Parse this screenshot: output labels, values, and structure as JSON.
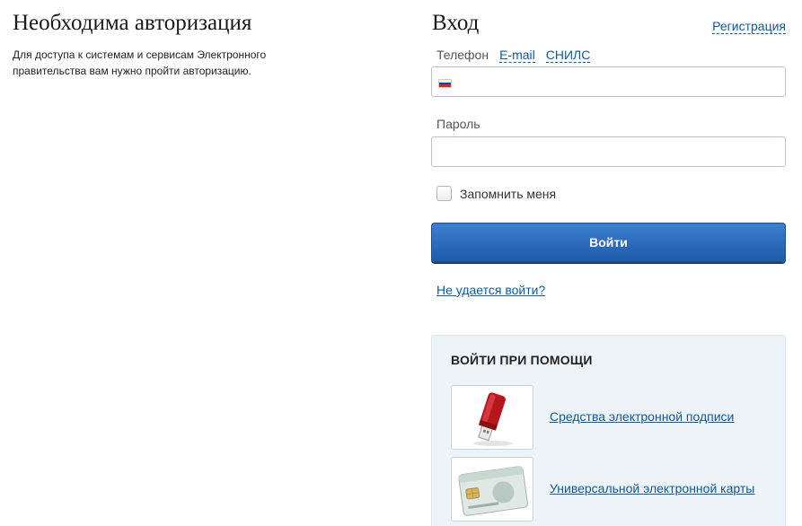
{
  "left": {
    "title": "Необходима авторизация",
    "description": "Для доступа к системам и сервисам Электронного правительства вам нужно пройти авторизацию."
  },
  "login": {
    "title": "Вход",
    "register_link": "Регистрация",
    "tabs": [
      {
        "label": "Телефон",
        "active": true
      },
      {
        "label": "E-mail",
        "active": false
      },
      {
        "label": "СНИЛС",
        "active": false
      }
    ],
    "phone_value": "",
    "password_label": "Пароль",
    "password_value": "",
    "remember_label": "Запомнить меня",
    "remember_checked": false,
    "submit_label": "Войти",
    "cant_login_link": "Не удается войти?"
  },
  "alt": {
    "title": "ВОЙТИ ПРИ ПОМОЩИ",
    "methods": [
      {
        "icon": "usb-token-icon",
        "label": "Средства электронной подписи"
      },
      {
        "icon": "smart-card-icon",
        "label": "Универсальной электронной карты"
      }
    ]
  },
  "colors": {
    "link": "#0f5a9c",
    "button_top": "#3b7fd0",
    "button_bottom": "#1f5ba8",
    "panel_bg": "#eef3f8",
    "input_border": "#b7c3cf"
  }
}
